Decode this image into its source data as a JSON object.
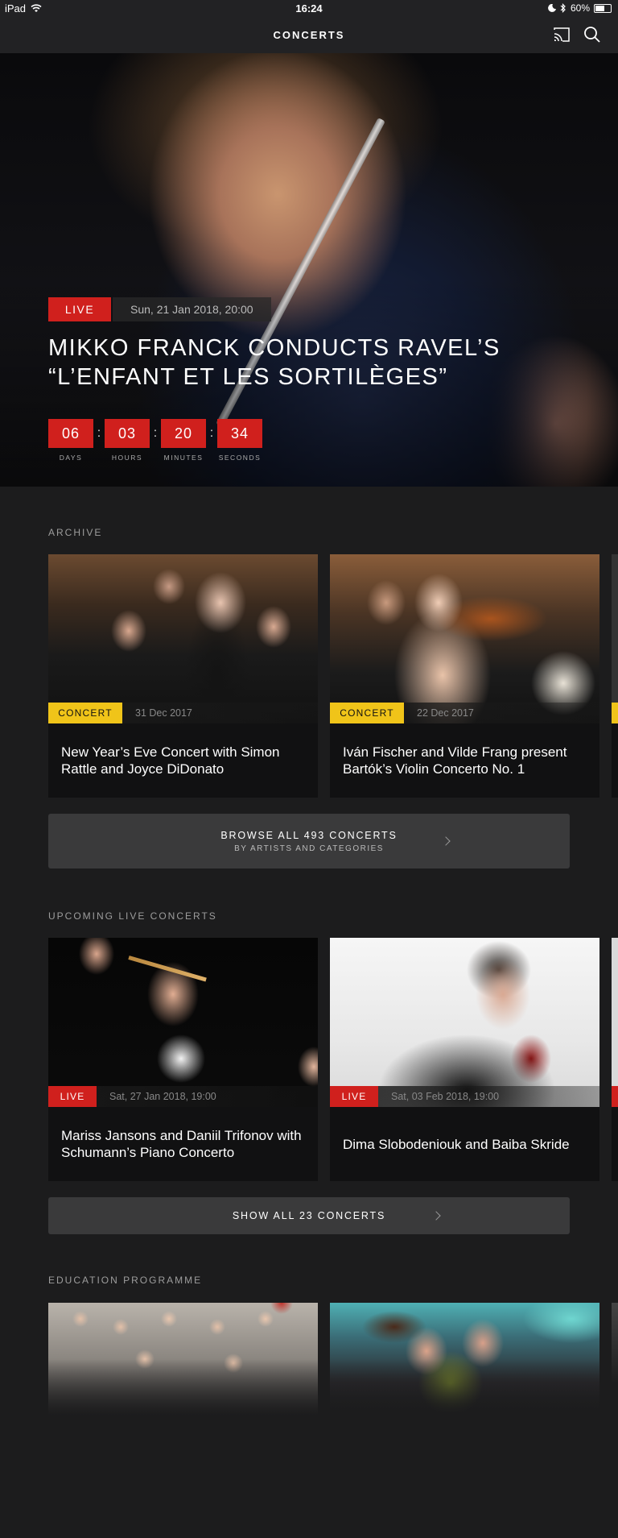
{
  "status_bar": {
    "device": "iPad",
    "time": "16:24",
    "battery": "60%",
    "battery_level": 0.6
  },
  "nav": {
    "title": "CONCERTS",
    "cast_icon": "cast-icon",
    "search_icon": "search-icon"
  },
  "hero": {
    "badge": "LIVE",
    "date": "Sun, 21 Jan 2018, 20:00",
    "title": "MIKKO FRANCK CONDUCTS RAVEL’S “L’ENFANT ET LES SORTILÈGES”",
    "countdown": [
      {
        "value": "06",
        "label": "DAYS"
      },
      {
        "value": "03",
        "label": "HOURS"
      },
      {
        "value": "20",
        "label": "MINUTES"
      },
      {
        "value": "34",
        "label": "SECONDS"
      }
    ],
    "separator": ":"
  },
  "archive": {
    "title": "ARCHIVE",
    "cards": [
      {
        "badge": "CONCERT",
        "date": "31 Dec 2017",
        "title": "New Year’s Eve Concert with Simon Rattle and Joyce DiDonato"
      },
      {
        "badge": "CONCERT",
        "date": "22 Dec 2017",
        "title": "Iván Fischer and Vilde Frang present Bartók’s Violin Concerto No. 1"
      }
    ],
    "browse_label": "BROWSE ALL 493 CONCERTS",
    "browse_sub": "BY ARTISTS AND CATEGORIES"
  },
  "upcoming": {
    "title": "UPCOMING LIVE CONCERTS",
    "cards": [
      {
        "badge": "LIVE",
        "date": "Sat, 27 Jan 2018, 19:00",
        "title": "Mariss Jansons and Daniil Trifonov with Schumann’s Piano Concerto"
      },
      {
        "badge": "LIVE",
        "date": "Sat, 03 Feb 2018, 19:00",
        "title": "Dima Slobodeniouk and Baiba Skride"
      }
    ],
    "show_all_label": "SHOW ALL 23 CONCERTS"
  },
  "education": {
    "title": "EDUCATION PROGRAMME"
  },
  "colors": {
    "live_red": "#d0201d",
    "concert_yellow": "#f0c419",
    "background": "#1c1c1d"
  }
}
